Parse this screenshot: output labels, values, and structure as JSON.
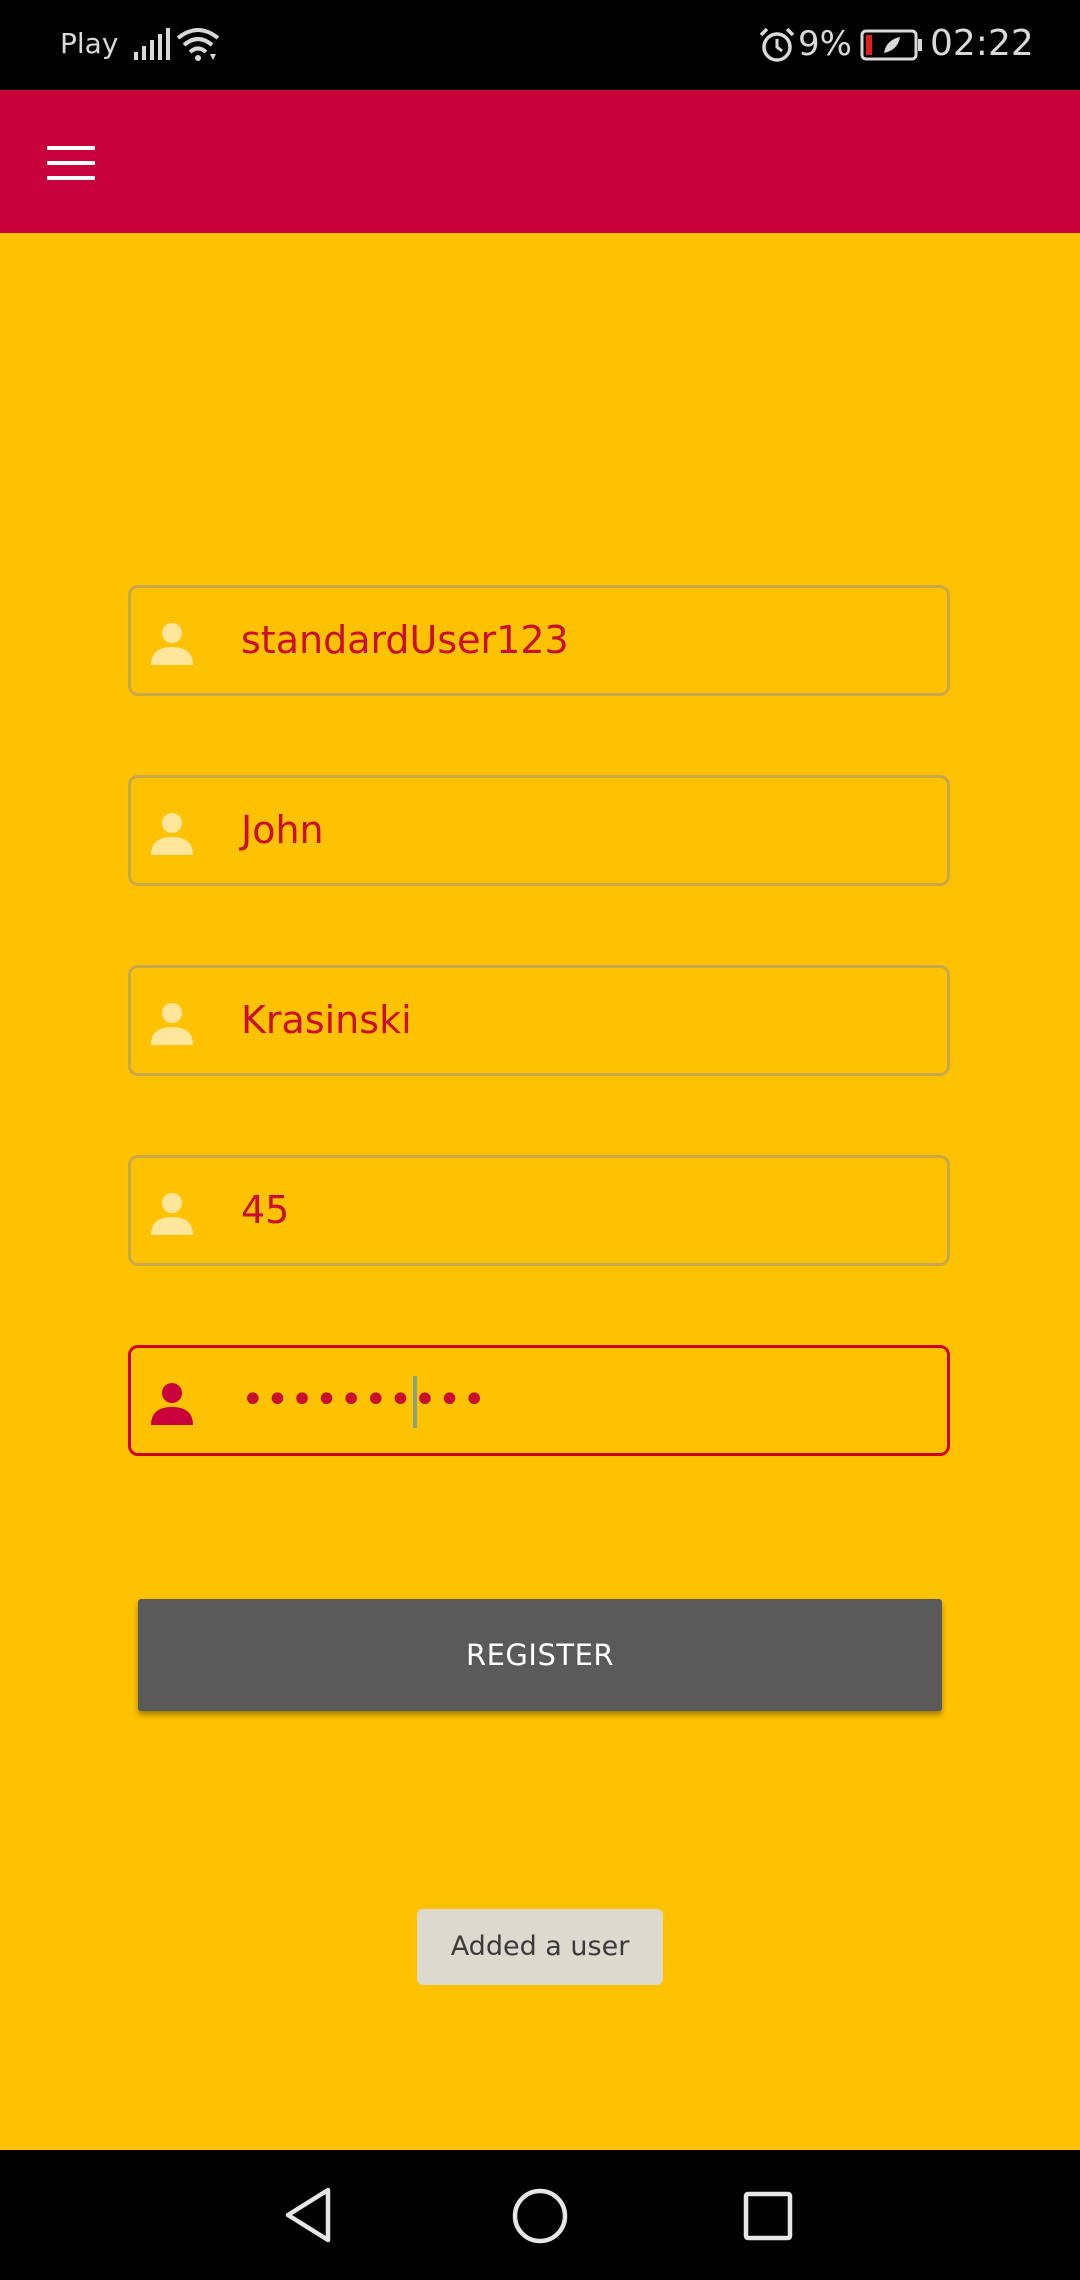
{
  "status_bar": {
    "carrier": "Play",
    "battery_percent": "9%",
    "time": "02:22",
    "icons": [
      "signal-icon",
      "wifi-icon",
      "alarm-icon",
      "battery-icon"
    ]
  },
  "app_bar": {
    "color": "#c8003c",
    "menu_icon": "menu-icon"
  },
  "form": {
    "username": "standardUser123",
    "first_name": "John",
    "last_name": "Krasinski",
    "age": "45",
    "password_masked": "••••••••••"
  },
  "register_button": "REGISTER",
  "toast": "Added a user",
  "colors": {
    "background": "#ffc200",
    "accent": "#c8003c",
    "field_text": "#c8102e",
    "button": "#5a5a5a"
  },
  "nav_bar": {
    "icons": [
      "back-icon",
      "home-icon",
      "recents-icon"
    ]
  }
}
